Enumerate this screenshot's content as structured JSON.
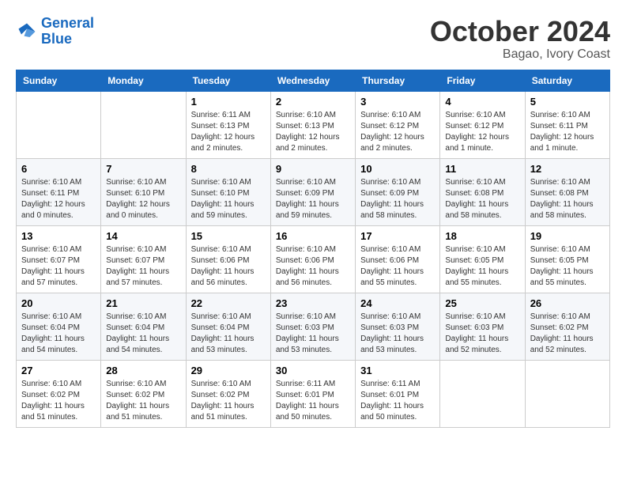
{
  "logo": {
    "text1": "General",
    "text2": "Blue"
  },
  "title": "October 2024",
  "location": "Bagao, Ivory Coast",
  "weekdays": [
    "Sunday",
    "Monday",
    "Tuesday",
    "Wednesday",
    "Thursday",
    "Friday",
    "Saturday"
  ],
  "weeks": [
    [
      {
        "day": "",
        "info": ""
      },
      {
        "day": "",
        "info": ""
      },
      {
        "day": "1",
        "info": "Sunrise: 6:11 AM\nSunset: 6:13 PM\nDaylight: 12 hours and 2 minutes."
      },
      {
        "day": "2",
        "info": "Sunrise: 6:10 AM\nSunset: 6:13 PM\nDaylight: 12 hours and 2 minutes."
      },
      {
        "day": "3",
        "info": "Sunrise: 6:10 AM\nSunset: 6:12 PM\nDaylight: 12 hours and 2 minutes."
      },
      {
        "day": "4",
        "info": "Sunrise: 6:10 AM\nSunset: 6:12 PM\nDaylight: 12 hours and 1 minute."
      },
      {
        "day": "5",
        "info": "Sunrise: 6:10 AM\nSunset: 6:11 PM\nDaylight: 12 hours and 1 minute."
      }
    ],
    [
      {
        "day": "6",
        "info": "Sunrise: 6:10 AM\nSunset: 6:11 PM\nDaylight: 12 hours and 0 minutes."
      },
      {
        "day": "7",
        "info": "Sunrise: 6:10 AM\nSunset: 6:10 PM\nDaylight: 12 hours and 0 minutes."
      },
      {
        "day": "8",
        "info": "Sunrise: 6:10 AM\nSunset: 6:10 PM\nDaylight: 11 hours and 59 minutes."
      },
      {
        "day": "9",
        "info": "Sunrise: 6:10 AM\nSunset: 6:09 PM\nDaylight: 11 hours and 59 minutes."
      },
      {
        "day": "10",
        "info": "Sunrise: 6:10 AM\nSunset: 6:09 PM\nDaylight: 11 hours and 58 minutes."
      },
      {
        "day": "11",
        "info": "Sunrise: 6:10 AM\nSunset: 6:08 PM\nDaylight: 11 hours and 58 minutes."
      },
      {
        "day": "12",
        "info": "Sunrise: 6:10 AM\nSunset: 6:08 PM\nDaylight: 11 hours and 58 minutes."
      }
    ],
    [
      {
        "day": "13",
        "info": "Sunrise: 6:10 AM\nSunset: 6:07 PM\nDaylight: 11 hours and 57 minutes."
      },
      {
        "day": "14",
        "info": "Sunrise: 6:10 AM\nSunset: 6:07 PM\nDaylight: 11 hours and 57 minutes."
      },
      {
        "day": "15",
        "info": "Sunrise: 6:10 AM\nSunset: 6:06 PM\nDaylight: 11 hours and 56 minutes."
      },
      {
        "day": "16",
        "info": "Sunrise: 6:10 AM\nSunset: 6:06 PM\nDaylight: 11 hours and 56 minutes."
      },
      {
        "day": "17",
        "info": "Sunrise: 6:10 AM\nSunset: 6:06 PM\nDaylight: 11 hours and 55 minutes."
      },
      {
        "day": "18",
        "info": "Sunrise: 6:10 AM\nSunset: 6:05 PM\nDaylight: 11 hours and 55 minutes."
      },
      {
        "day": "19",
        "info": "Sunrise: 6:10 AM\nSunset: 6:05 PM\nDaylight: 11 hours and 55 minutes."
      }
    ],
    [
      {
        "day": "20",
        "info": "Sunrise: 6:10 AM\nSunset: 6:04 PM\nDaylight: 11 hours and 54 minutes."
      },
      {
        "day": "21",
        "info": "Sunrise: 6:10 AM\nSunset: 6:04 PM\nDaylight: 11 hours and 54 minutes."
      },
      {
        "day": "22",
        "info": "Sunrise: 6:10 AM\nSunset: 6:04 PM\nDaylight: 11 hours and 53 minutes."
      },
      {
        "day": "23",
        "info": "Sunrise: 6:10 AM\nSunset: 6:03 PM\nDaylight: 11 hours and 53 minutes."
      },
      {
        "day": "24",
        "info": "Sunrise: 6:10 AM\nSunset: 6:03 PM\nDaylight: 11 hours and 53 minutes."
      },
      {
        "day": "25",
        "info": "Sunrise: 6:10 AM\nSunset: 6:03 PM\nDaylight: 11 hours and 52 minutes."
      },
      {
        "day": "26",
        "info": "Sunrise: 6:10 AM\nSunset: 6:02 PM\nDaylight: 11 hours and 52 minutes."
      }
    ],
    [
      {
        "day": "27",
        "info": "Sunrise: 6:10 AM\nSunset: 6:02 PM\nDaylight: 11 hours and 51 minutes."
      },
      {
        "day": "28",
        "info": "Sunrise: 6:10 AM\nSunset: 6:02 PM\nDaylight: 11 hours and 51 minutes."
      },
      {
        "day": "29",
        "info": "Sunrise: 6:10 AM\nSunset: 6:02 PM\nDaylight: 11 hours and 51 minutes."
      },
      {
        "day": "30",
        "info": "Sunrise: 6:11 AM\nSunset: 6:01 PM\nDaylight: 11 hours and 50 minutes."
      },
      {
        "day": "31",
        "info": "Sunrise: 6:11 AM\nSunset: 6:01 PM\nDaylight: 11 hours and 50 minutes."
      },
      {
        "day": "",
        "info": ""
      },
      {
        "day": "",
        "info": ""
      }
    ]
  ]
}
